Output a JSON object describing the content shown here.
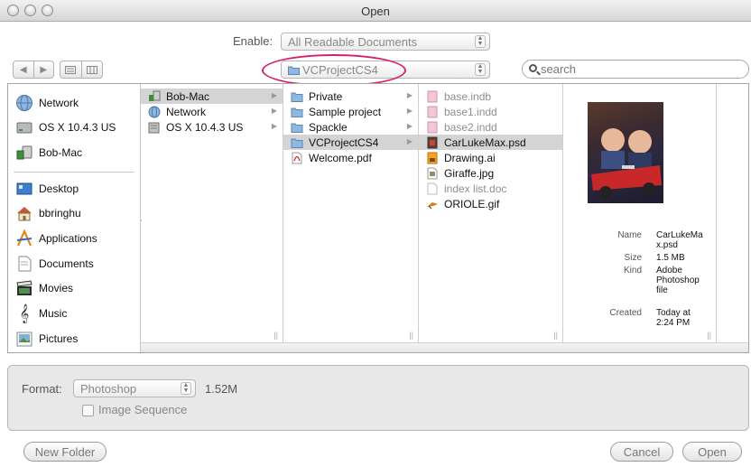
{
  "window": {
    "title": "Open"
  },
  "enable": {
    "label": "Enable:",
    "value": "All Readable Documents"
  },
  "location": {
    "value": "VCProjectCS4"
  },
  "search": {
    "placeholder": "search"
  },
  "sidebar": {
    "devices": [
      {
        "label": "Network",
        "icon": "network-globe-icon"
      },
      {
        "label": "OS X 10.4.3 US",
        "icon": "hard-disk-icon"
      },
      {
        "label": "Bob-Mac",
        "icon": "computer-icon"
      }
    ],
    "places": [
      {
        "label": "Desktop",
        "icon": "desktop-icon"
      },
      {
        "label": "bbringhu",
        "icon": "home-icon"
      },
      {
        "label": "Applications",
        "icon": "applications-icon"
      },
      {
        "label": "Documents",
        "icon": "documents-icon"
      },
      {
        "label": "Movies",
        "icon": "movies-icon"
      },
      {
        "label": "Music",
        "icon": "music-icon"
      },
      {
        "label": "Pictures",
        "icon": "pictures-icon"
      }
    ]
  },
  "columns": {
    "col1": [
      {
        "label": "Bob-Mac",
        "icon": "computer-icon",
        "selected": true
      },
      {
        "label": "Network",
        "icon": "network-globe-icon"
      },
      {
        "label": "OS X 10.4.3 US",
        "icon": "hard-disk-icon"
      }
    ],
    "col2": [
      {
        "label": "Private",
        "icon": "folder-icon"
      },
      {
        "label": "Sample project",
        "icon": "folder-icon"
      },
      {
        "label": "Spackle",
        "icon": "folder-icon"
      },
      {
        "label": "VCProjectCS4",
        "icon": "folder-icon",
        "selected": true
      },
      {
        "label": "Welcome.pdf",
        "icon": "pdf-icon"
      }
    ],
    "col3": [
      {
        "label": "base.indb",
        "icon": "indesign-book-icon",
        "dim": true
      },
      {
        "label": "base1.indd",
        "icon": "indesign-doc-icon",
        "dim": true
      },
      {
        "label": "base2.indd",
        "icon": "indesign-doc-icon",
        "dim": true
      },
      {
        "label": "CarLukeMax.psd",
        "icon": "photoshop-file-icon",
        "selected": true
      },
      {
        "label": "Drawing.ai",
        "icon": "illustrator-file-icon"
      },
      {
        "label": "Giraffe.jpg",
        "icon": "image-file-icon"
      },
      {
        "label": "index list.doc",
        "icon": "generic-doc-icon",
        "dim": true
      },
      {
        "label": "ORIOLE.gif",
        "icon": "gif-file-icon"
      }
    ]
  },
  "preview": {
    "name_label": "Name",
    "name_value": "CarLukeMax.psd",
    "size_label": "Size",
    "size_value": "1.5 MB",
    "kind_label": "Kind",
    "kind_value": "Adobe Photoshop file",
    "created_label": "Created",
    "created_value": "Today at 2:24 PM"
  },
  "format": {
    "label": "Format:",
    "value": "Photoshop",
    "size": "1.52M",
    "sequence_label": "Image Sequence"
  },
  "buttons": {
    "new_folder": "New Folder",
    "cancel": "Cancel",
    "open": "Open"
  },
  "colors": {
    "highlight": "#d3216d",
    "selection": "#d4d4d4",
    "folder": "#5b9bd8"
  }
}
